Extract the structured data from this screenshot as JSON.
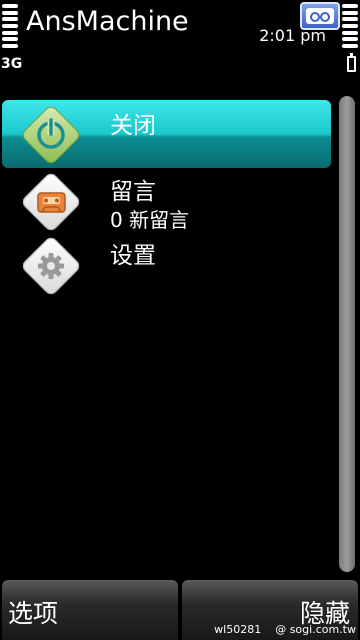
{
  "header": {
    "app_title": "AnsMachine",
    "clock": "2:01 pm",
    "network": "3G"
  },
  "menu": {
    "items": [
      {
        "label": "关闭",
        "icon": "power-icon",
        "selected": true
      },
      {
        "label": "留言",
        "sublabel": "0 新留言",
        "icon": "cassette-icon"
      },
      {
        "label": "设置",
        "icon": "gear-icon"
      }
    ]
  },
  "softkeys": {
    "left": "选项",
    "right": "隐藏"
  },
  "watermark": {
    "id": "wl50281",
    "site": "@ sogi.com.tw"
  },
  "colors": {
    "highlight": "#1bc8cc",
    "background": "#000000"
  }
}
